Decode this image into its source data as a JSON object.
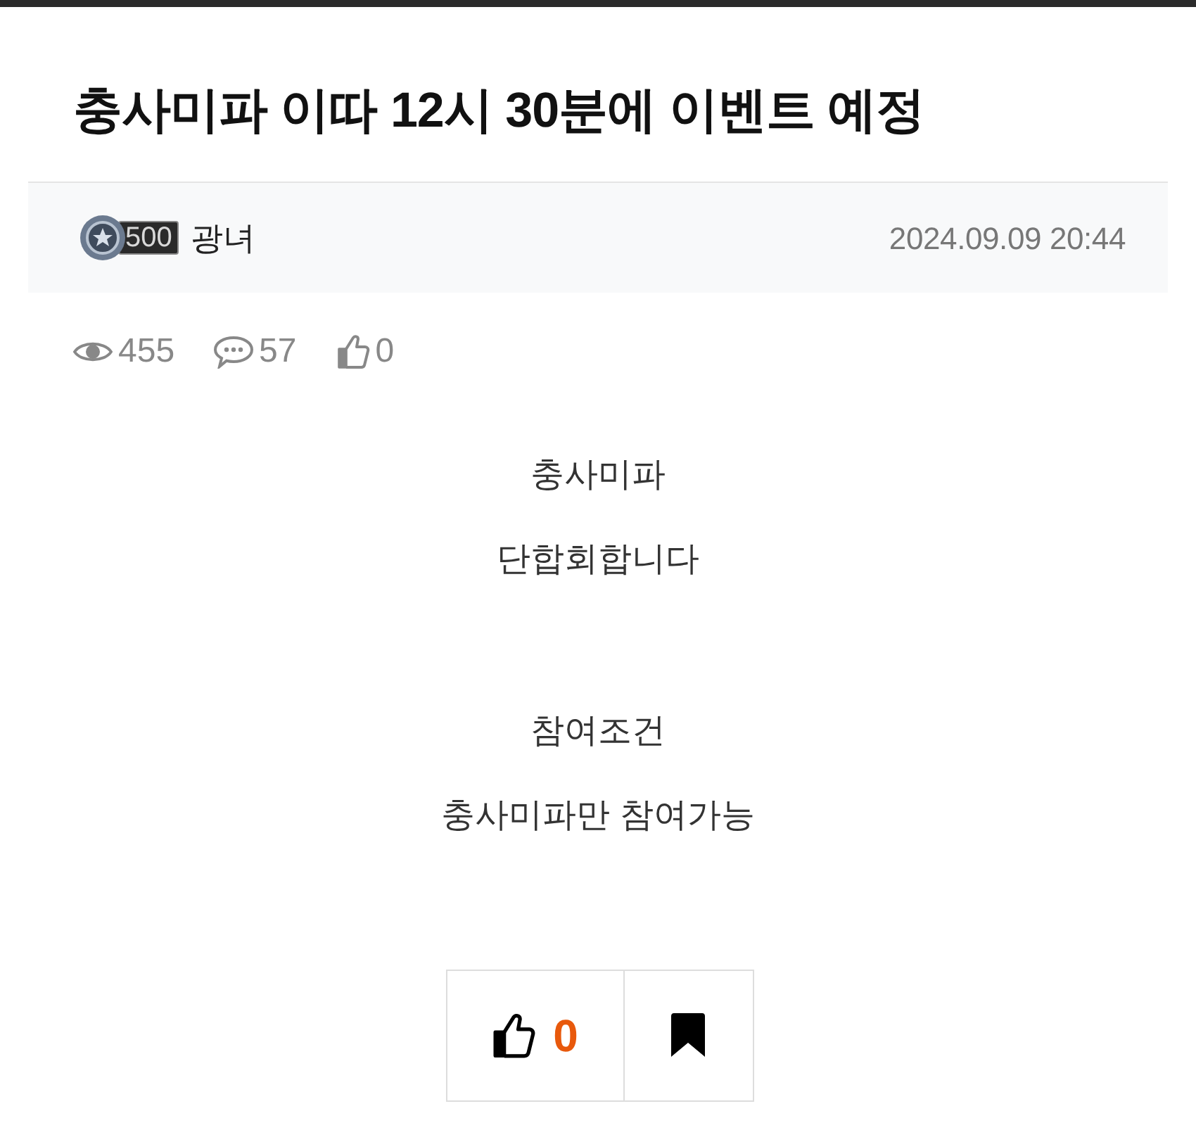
{
  "post": {
    "title": "충사미파 이따 12시 30분에 이벤트 예정"
  },
  "author": {
    "level_badge": "500",
    "name": "광녀",
    "date": "2024.09.09 20:44"
  },
  "stats": {
    "views": "455",
    "comments": "57",
    "likes": "0"
  },
  "body": [
    [
      "충사미파",
      "단합회합니다"
    ],
    [
      "참여조건",
      "충사미파만 참여가능"
    ]
  ],
  "actions": {
    "like_count": "0"
  }
}
